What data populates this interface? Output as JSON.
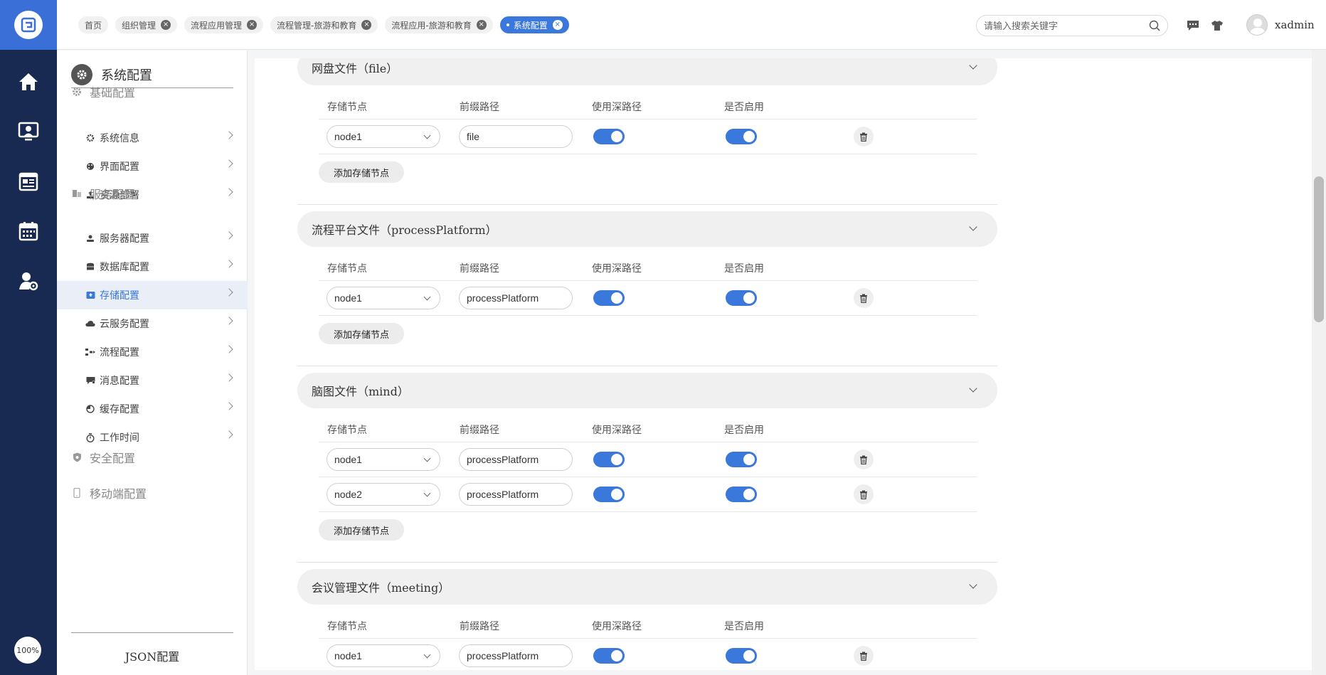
{
  "topbar": {
    "tabs": [
      {
        "label": "首页",
        "closable": false
      },
      {
        "label": "组织管理",
        "closable": true
      },
      {
        "label": "流程应用管理",
        "closable": true
      },
      {
        "label": "流程管理-旅游和教育",
        "closable": true
      },
      {
        "label": "流程应用-旅游和教育",
        "closable": true
      },
      {
        "label": "系统配置",
        "closable": true,
        "active": true
      }
    ],
    "search_placeholder": "请输入搜索关键字",
    "username": "xadmin"
  },
  "rail": {
    "zoom": "100%",
    "icons": [
      "home-icon",
      "monitor-user-icon",
      "news-icon",
      "calendar-icon",
      "user-settings-icon"
    ]
  },
  "sidebar": {
    "title": "系统配置",
    "groups": [
      {
        "label": "基础配置",
        "icon": "gear-icon"
      },
      {
        "label": "服务配置",
        "icon": "server-icon"
      },
      {
        "label": "安全配置",
        "icon": "shield-icon"
      },
      {
        "label": "移动端配置",
        "icon": "mobile-icon"
      }
    ],
    "items": [
      {
        "label": "系统信息",
        "icon": "gear-icon"
      },
      {
        "label": "界面配置",
        "icon": "palette-icon"
      },
      {
        "label": "资源部署",
        "icon": "deploy-icon"
      },
      {
        "label": "服务器配置",
        "icon": "server-user-icon"
      },
      {
        "label": "数据库配置",
        "icon": "database-icon"
      },
      {
        "label": "存储配置",
        "icon": "storage-icon",
        "selected": true
      },
      {
        "label": "云服务配置",
        "icon": "cloud-icon"
      },
      {
        "label": "流程配置",
        "icon": "flow-icon"
      },
      {
        "label": "消息配置",
        "icon": "message-icon"
      },
      {
        "label": "缓存配置",
        "icon": "pie-icon"
      },
      {
        "label": "工作时间",
        "icon": "stopwatch-icon"
      }
    ],
    "footer": "JSON配置"
  },
  "columns": {
    "node": "存储节点",
    "prefix": "前缀路径",
    "deep_path": "使用深路径",
    "enabled": "是否启用"
  },
  "add_label": "添加存储节点",
  "sections": [
    {
      "title": "网盘文件（file）",
      "rows": [
        {
          "node": "node1",
          "prefix": "file",
          "deep": true,
          "enabled": true
        }
      ]
    },
    {
      "title": "流程平台文件（processPlatform）",
      "rows": [
        {
          "node": "node1",
          "prefix": "processPlatform",
          "deep": true,
          "enabled": true
        }
      ]
    },
    {
      "title": "脑图文件（mind）",
      "rows": [
        {
          "node": "node1",
          "prefix": "processPlatform",
          "deep": true,
          "enabled": true
        },
        {
          "node": "node2",
          "prefix": "processPlatform",
          "deep": true,
          "enabled": true
        }
      ]
    },
    {
      "title": "会议管理文件（meeting）",
      "rows": [
        {
          "node": "node1",
          "prefix": "processPlatform",
          "deep": true,
          "enabled": true
        }
      ]
    }
  ],
  "colors": {
    "accent": "#3a78dc",
    "rail": "#182a52"
  }
}
